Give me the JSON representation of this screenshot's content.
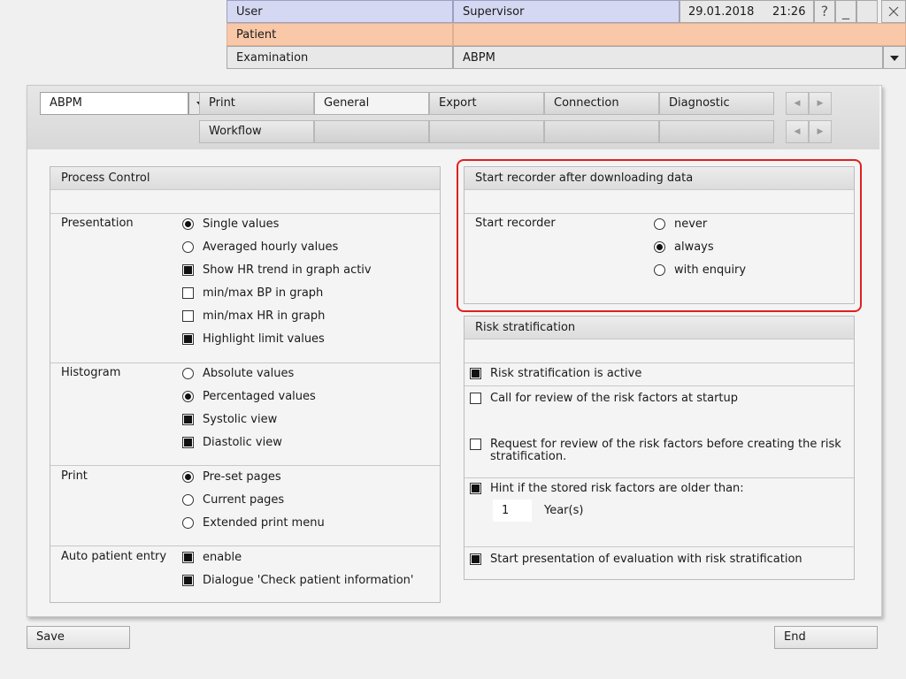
{
  "header": {
    "user_label": "User",
    "user_value": "Supervisor",
    "date": "29.01.2018",
    "time": "21:26",
    "help_icon": "?",
    "minimize_icon": "_",
    "patient_label": "Patient",
    "patient_value": "",
    "examination_label": "Examination",
    "examination_value": "ABPM"
  },
  "module_select": {
    "value": "ABPM"
  },
  "tabs": {
    "row1": [
      "Print",
      "General",
      "Export",
      "Connection",
      "Diagnostic"
    ],
    "row2": [
      "Workflow",
      "",
      "",
      "",
      ""
    ],
    "active": "General"
  },
  "process_control": {
    "title": "Process Control",
    "presentation": {
      "label": "Presentation",
      "options": [
        {
          "type": "radio",
          "label": "Single values",
          "checked": true
        },
        {
          "type": "radio",
          "label": "Averaged hourly values",
          "checked": false
        },
        {
          "type": "check",
          "label": "Show HR trend in graph activ",
          "checked": true
        },
        {
          "type": "check",
          "label": "min/max BP in graph",
          "checked": false
        },
        {
          "type": "check",
          "label": "min/max HR in graph",
          "checked": false
        },
        {
          "type": "check",
          "label": "Highlight limit values",
          "checked": true
        }
      ]
    },
    "histogram": {
      "label": "Histogram",
      "options": [
        {
          "type": "radio",
          "label": "Absolute values",
          "checked": false
        },
        {
          "type": "radio",
          "label": "Percentaged values",
          "checked": true
        },
        {
          "type": "check",
          "label": "Systolic view",
          "checked": true
        },
        {
          "type": "check",
          "label": "Diastolic view",
          "checked": true
        }
      ]
    },
    "print": {
      "label": "Print",
      "options": [
        {
          "type": "radio",
          "label": "Pre-set pages",
          "checked": true
        },
        {
          "type": "radio",
          "label": "Current pages",
          "checked": false
        },
        {
          "type": "radio",
          "label": "Extended print menu",
          "checked": false
        }
      ]
    },
    "auto_patient_entry": {
      "label": "Auto patient entry",
      "options": [
        {
          "type": "check",
          "label": "enable",
          "checked": true
        },
        {
          "type": "check",
          "label": "Dialogue 'Check patient information'",
          "checked": true
        }
      ]
    }
  },
  "start_recorder": {
    "title": "Start recorder after downloading data",
    "label": "Start recorder",
    "options": [
      {
        "label": "never",
        "checked": false
      },
      {
        "label": "always",
        "checked": true
      },
      {
        "label": "with enquiry",
        "checked": false
      }
    ]
  },
  "risk": {
    "title": "Risk stratification",
    "active_label": "Risk stratification is active",
    "active_checked": true,
    "startup_review_label": "Call for review of the risk factors at startup",
    "startup_review_checked": false,
    "request_review_label_1": "Request for review of the risk factors before creating the risk",
    "request_review_label_2": "stratification.",
    "request_review_checked": false,
    "hint_label": "Hint if the stored risk factors are older than:",
    "hint_checked": true,
    "years_value": "1",
    "years_unit": "Year(s)",
    "presentation_label": "Start presentation of evaluation with risk stratification",
    "presentation_checked": true
  },
  "footer": {
    "save_label": "Save",
    "end_label": "End"
  }
}
